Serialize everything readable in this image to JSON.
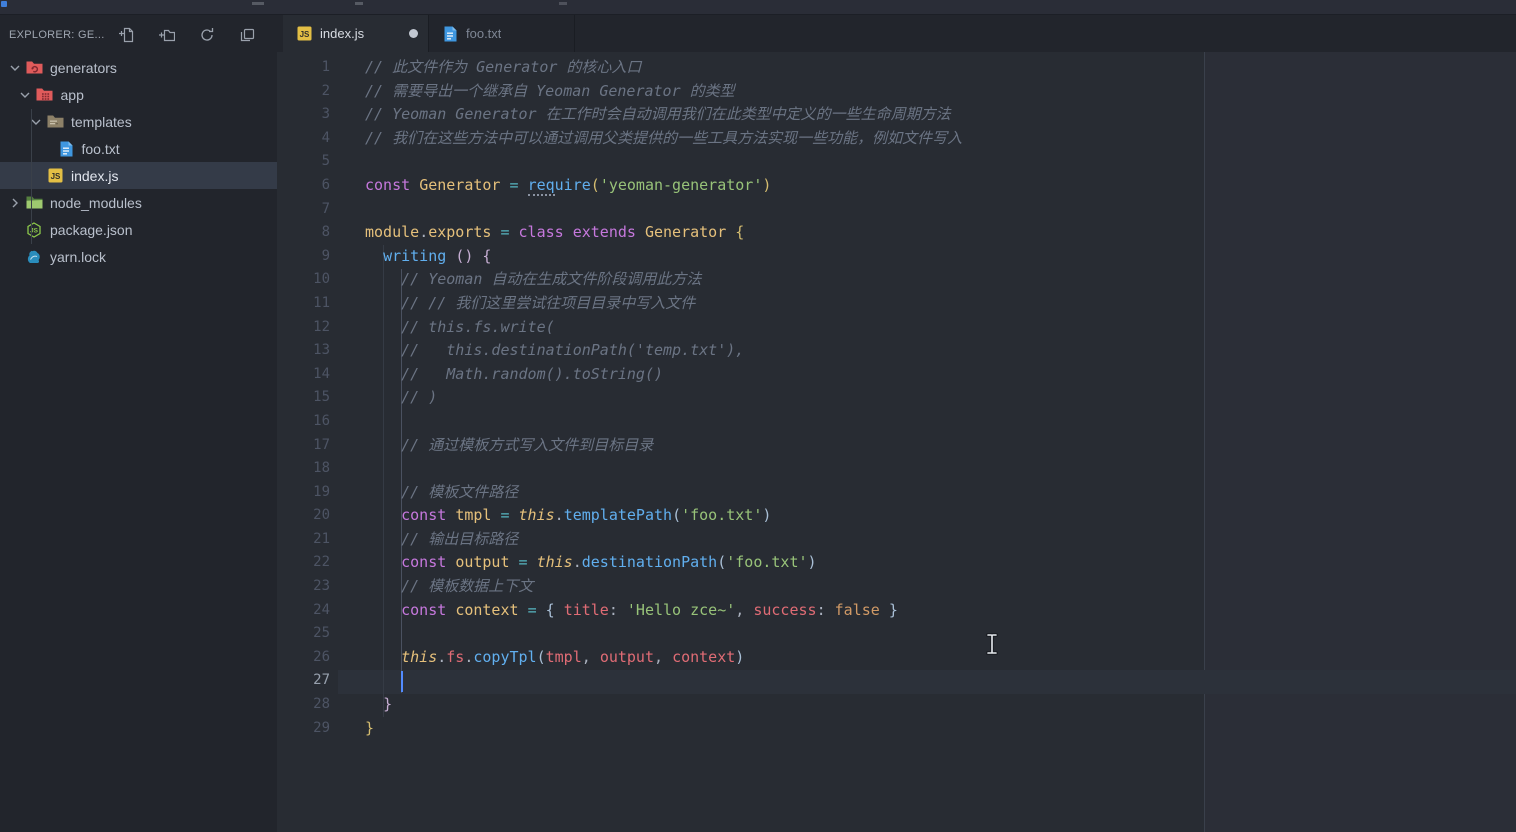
{
  "titlebar": {
    "fragments": true
  },
  "sidebar": {
    "header": {
      "title": "EXPLORER: GE...",
      "actions": [
        {
          "name": "new-file-icon",
          "label": "New File"
        },
        {
          "name": "new-folder-icon",
          "label": "New Folder"
        },
        {
          "name": "refresh-icon",
          "label": "Refresh Explorer"
        },
        {
          "name": "collapse-all-icon",
          "label": "Collapse Folders"
        }
      ]
    },
    "tree": [
      {
        "label": "generators",
        "type": "folder",
        "icon": "folder-generators",
        "depth": 0,
        "expanded": true
      },
      {
        "label": "app",
        "type": "folder",
        "icon": "folder-app",
        "depth": 1,
        "expanded": true
      },
      {
        "label": "templates",
        "type": "folder",
        "icon": "folder-templates",
        "depth": 2,
        "expanded": true
      },
      {
        "label": "foo.txt",
        "type": "file",
        "icon": "file-text",
        "depth": 3
      },
      {
        "label": "index.js",
        "type": "file",
        "icon": "file-js",
        "depth": 2,
        "selected": true
      },
      {
        "label": "node_modules",
        "type": "folder",
        "icon": "folder-node",
        "depth": 0,
        "expanded": false
      },
      {
        "label": "package.json",
        "type": "file",
        "icon": "file-node",
        "depth": 0
      },
      {
        "label": "yarn.lock",
        "type": "file",
        "icon": "file-yarn",
        "depth": 0
      }
    ]
  },
  "tabs": [
    {
      "label": "index.js",
      "icon": "file-js",
      "active": true,
      "modified": true
    },
    {
      "label": "foo.txt",
      "icon": "file-text",
      "active": false,
      "modified": false
    }
  ],
  "editor": {
    "cursor": {
      "line": 27,
      "col": 4
    },
    "lines": [
      [
        [
          "cm",
          "// 此文件作为 Generator 的核心入口"
        ]
      ],
      [
        [
          "cm",
          "// 需要导出一个继承自 Yeoman Generator 的类型"
        ]
      ],
      [
        [
          "cm",
          "// Yeoman Generator 在工作时会自动调用我们在此类型中定义的一些生命周期方法"
        ]
      ],
      [
        [
          "cm",
          "// 我们在这些方法中可以通过调用父类提供的一些工具方法实现一些功能，例如文件写入"
        ]
      ],
      [],
      [
        [
          "kw",
          "const "
        ],
        [
          "gold",
          "Generator"
        ],
        [
          "p",
          " "
        ],
        [
          "cy",
          "="
        ],
        [
          "p",
          " "
        ],
        [
          "fnh",
          "req"
        ],
        [
          "fn",
          "uire"
        ],
        [
          "b1",
          "("
        ],
        [
          "str",
          "'yeoman-generator'"
        ],
        [
          "b1",
          ")"
        ]
      ],
      [],
      [
        [
          "gold",
          "module"
        ],
        [
          "p",
          "."
        ],
        [
          "gold",
          "exports"
        ],
        [
          "p",
          " "
        ],
        [
          "cy",
          "="
        ],
        [
          "p",
          " "
        ],
        [
          "kw",
          "class"
        ],
        [
          "p",
          " "
        ],
        [
          "kw",
          "extends"
        ],
        [
          "p",
          " "
        ],
        [
          "gold",
          "Generator"
        ],
        [
          "p",
          " "
        ],
        [
          "b1",
          "{"
        ]
      ],
      [
        [
          "p",
          "  "
        ],
        [
          "fn",
          "writing"
        ],
        [
          "p",
          " "
        ],
        [
          "b2",
          "()"
        ],
        [
          "p",
          " "
        ],
        [
          "b2",
          "{"
        ]
      ],
      [
        [
          "p",
          "    "
        ],
        [
          "cm",
          "// Yeoman 自动在生成文件阶段调用此方法"
        ]
      ],
      [
        [
          "p",
          "    "
        ],
        [
          "cm",
          "// // 我们这里尝试往项目目录中写入文件"
        ]
      ],
      [
        [
          "p",
          "    "
        ],
        [
          "cm",
          "// this.fs.write("
        ]
      ],
      [
        [
          "p",
          "    "
        ],
        [
          "cm",
          "//   this.destinationPath('temp.txt'),"
        ]
      ],
      [
        [
          "p",
          "    "
        ],
        [
          "cm",
          "//   Math.random().toString()"
        ]
      ],
      [
        [
          "p",
          "    "
        ],
        [
          "cm",
          "// )"
        ]
      ],
      [],
      [
        [
          "p",
          "    "
        ],
        [
          "cm",
          "// 通过模板方式写入文件到目标目录"
        ]
      ],
      [],
      [
        [
          "p",
          "    "
        ],
        [
          "cm",
          "// 模板文件路径"
        ]
      ],
      [
        [
          "p",
          "    "
        ],
        [
          "kw",
          "const "
        ],
        [
          "gold",
          "tmpl"
        ],
        [
          "p",
          " "
        ],
        [
          "cy",
          "="
        ],
        [
          "p",
          " "
        ],
        [
          "this",
          "this"
        ],
        [
          "p",
          "."
        ],
        [
          "fn",
          "templatePath"
        ],
        [
          "b3",
          "("
        ],
        [
          "str",
          "'foo.txt'"
        ],
        [
          "b3",
          ")"
        ]
      ],
      [
        [
          "p",
          "    "
        ],
        [
          "cm",
          "// 输出目标路径"
        ]
      ],
      [
        [
          "p",
          "    "
        ],
        [
          "kw",
          "const "
        ],
        [
          "gold",
          "output"
        ],
        [
          "p",
          " "
        ],
        [
          "cy",
          "="
        ],
        [
          "p",
          " "
        ],
        [
          "this",
          "this"
        ],
        [
          "p",
          "."
        ],
        [
          "fn",
          "destinationPath"
        ],
        [
          "b3",
          "("
        ],
        [
          "str",
          "'foo.txt'"
        ],
        [
          "b3",
          ")"
        ]
      ],
      [
        [
          "p",
          "    "
        ],
        [
          "cm",
          "// 模板数据上下文"
        ]
      ],
      [
        [
          "p",
          "    "
        ],
        [
          "kw",
          "const "
        ],
        [
          "gold",
          "context"
        ],
        [
          "p",
          " "
        ],
        [
          "cy",
          "="
        ],
        [
          "p",
          " "
        ],
        [
          "b3",
          "{"
        ],
        [
          "p",
          " "
        ],
        [
          "red",
          "title"
        ],
        [
          "p",
          ": "
        ],
        [
          "str",
          "'Hello zce~'"
        ],
        [
          "p",
          ", "
        ],
        [
          "red",
          "success"
        ],
        [
          "p",
          ": "
        ],
        [
          "num",
          "false"
        ],
        [
          "p",
          " "
        ],
        [
          "b3",
          "}"
        ]
      ],
      [],
      [
        [
          "p",
          "    "
        ],
        [
          "this",
          "this"
        ],
        [
          "p",
          "."
        ],
        [
          "red",
          "fs"
        ],
        [
          "p",
          "."
        ],
        [
          "fn",
          "copyTpl"
        ],
        [
          "b3",
          "("
        ],
        [
          "red",
          "tmpl"
        ],
        [
          "p",
          ", "
        ],
        [
          "red",
          "output"
        ],
        [
          "p",
          ", "
        ],
        [
          "red",
          "context"
        ],
        [
          "b3",
          ")"
        ]
      ],
      [
        [
          "p",
          "    "
        ]
      ],
      [
        [
          "p",
          "  "
        ],
        [
          "b2",
          "}"
        ]
      ],
      [
        [
          "b1",
          "}"
        ]
      ]
    ]
  },
  "palette": {
    "editor-bg": "#282c33",
    "sidebar-bg": "#22252c",
    "titlebar-bg": "#2a2d37",
    "tabbar-bg": "#22252c",
    "selection-row": "#343b48",
    "current-line": "#2c313a",
    "accent-cursor": "#528bff",
    "tok-kw": "#c678dd",
    "tok-gold": "#e5c07b",
    "tok-cy": "#56b6c2",
    "tok-fn": "#61afef",
    "tok-str": "#98c379",
    "tok-red": "#e06c75",
    "tok-num": "#d19a66",
    "tok-p": "#abb2bf",
    "tok-cm": "#6b7484"
  }
}
